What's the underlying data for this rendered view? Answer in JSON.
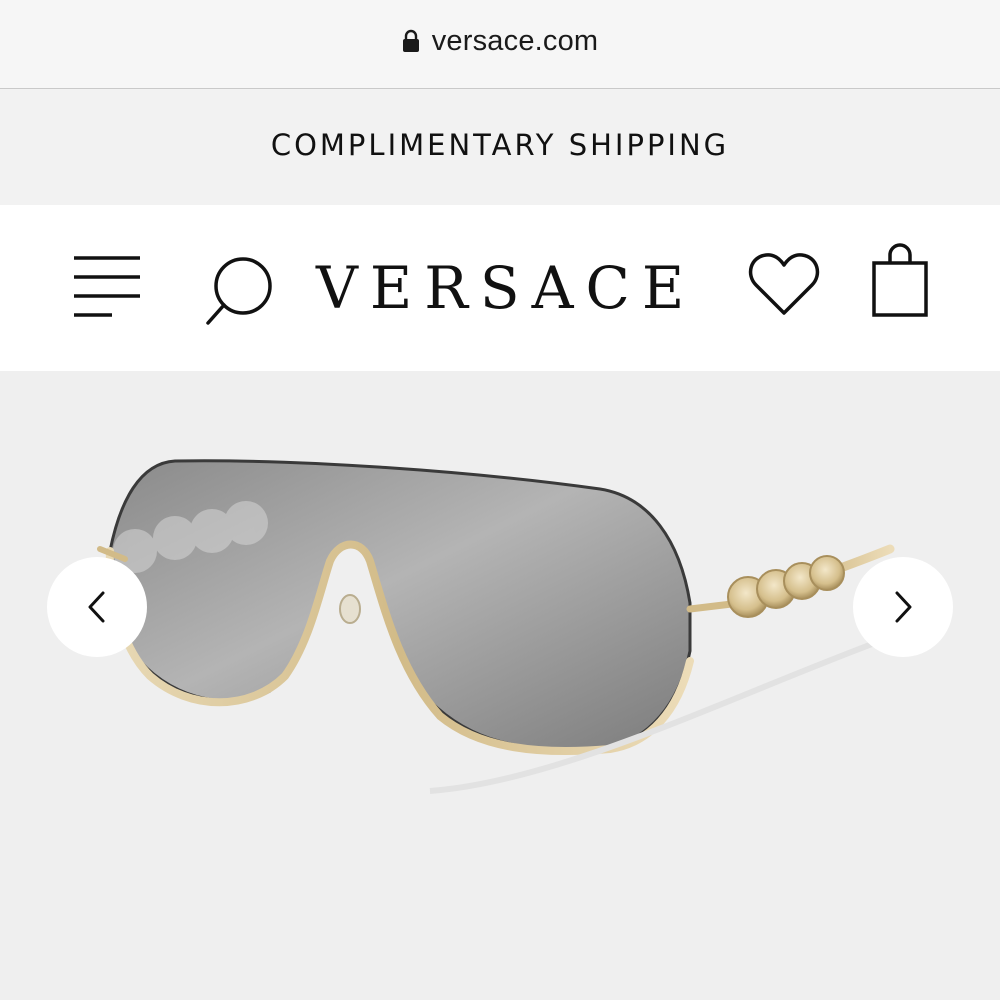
{
  "browser": {
    "url": "versace.com",
    "lock_icon": "lock-icon"
  },
  "promo": {
    "text": "COMPLIMENTARY SHIPPING"
  },
  "header": {
    "logo": "VERSACE",
    "icons": [
      "menu-icon",
      "search-icon",
      "heart-icon",
      "shopping-bag-icon"
    ]
  },
  "carousel": {
    "prev_icon": "chevron-left-icon",
    "next_icon": "chevron-right-icon"
  },
  "colors": {
    "background": "#efefef",
    "text": "#111111",
    "frame_gold": "#d8c49a",
    "lens_gray": "#8c8c8c"
  }
}
